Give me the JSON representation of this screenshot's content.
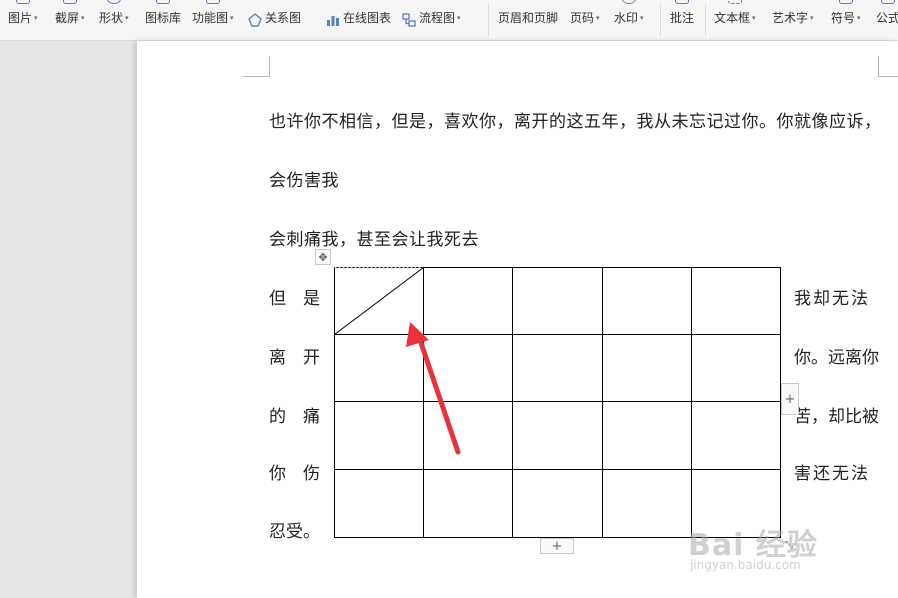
{
  "toolbar": {
    "items": [
      {
        "label": "图片",
        "dropdown": true
      },
      {
        "label": "截屏",
        "dropdown": true
      },
      {
        "label": "形状",
        "dropdown": true
      },
      {
        "label": "图标库",
        "dropdown": false
      },
      {
        "label": "功能图",
        "dropdown": true
      },
      {
        "label": "关系图",
        "dropdown": false
      },
      {
        "label": "在线图表",
        "dropdown": false
      },
      {
        "label": "流程图",
        "dropdown": true
      },
      {
        "label": "页眉和页脚",
        "dropdown": false
      },
      {
        "label": "页码",
        "dropdown": true
      },
      {
        "label": "水印",
        "dropdown": true
      },
      {
        "label": "批注",
        "dropdown": false
      },
      {
        "label": "文本框",
        "dropdown": true
      },
      {
        "label": "艺术字",
        "dropdown": true
      },
      {
        "label": "符号",
        "dropdown": true
      },
      {
        "label": "公式",
        "dropdown": false
      }
    ],
    "caret": "▾"
  },
  "document": {
    "lines": [
      "也许你不相信，但是，喜欢你，离开的这五年，我从未忘记过你。你就像应诉，",
      "会伤害我",
      "会刺痛我，甚至会让我死去"
    ],
    "left_text": [
      "但　是",
      "离　开",
      "的　痛",
      "你　伤",
      "忍受。"
    ],
    "right_text": [
      "我却无法",
      "你。远离你",
      "苦，却比被",
      "害还无法"
    ]
  },
  "table": {
    "rows": 4,
    "cols": 5,
    "diagonal_cell": "top-left"
  },
  "handles": {
    "move": "✥",
    "add_col": "+",
    "add_row": "+",
    "resize": "⤡"
  },
  "annotation": {
    "color": "#e8333a"
  },
  "watermark": {
    "main": "Bai 经验",
    "sub": "jingyan.baidu.com"
  }
}
